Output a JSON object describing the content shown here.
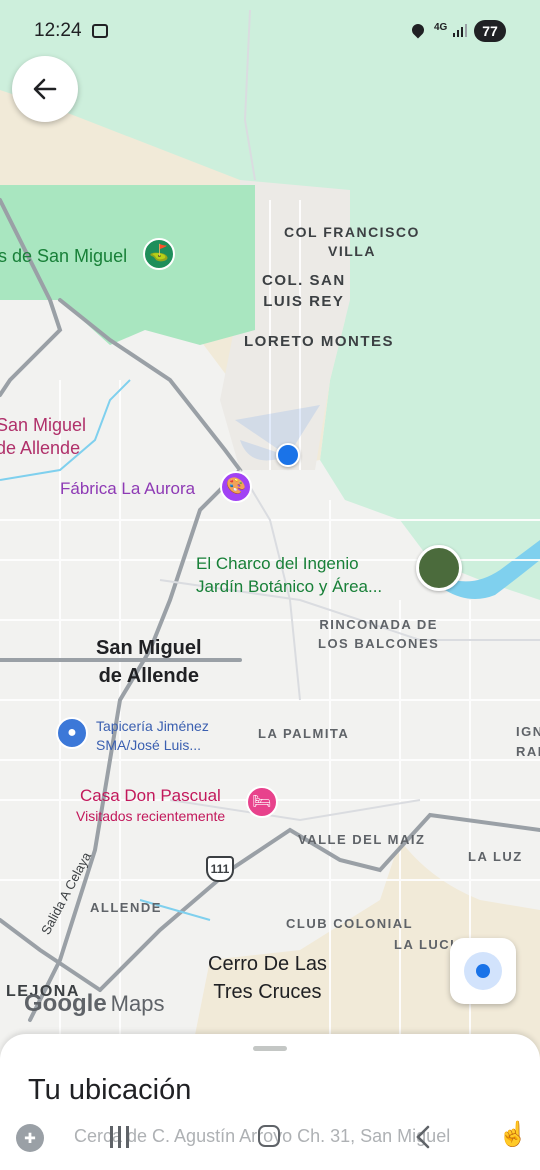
{
  "status_bar": {
    "time": "12:24",
    "network": "4G",
    "battery": "77"
  },
  "map": {
    "areas": {
      "col_francisco_villa": "COL FRANCISCO\nVILLA",
      "col_san_luis_rey": "COL. SAN\nLUIS REY",
      "loreto_montes": "LORETO MONTES",
      "rinconada": "RINCONADA DE\nLOS BALCONES",
      "la_palmita": "LA PALMITA",
      "valle_del_maiz": "VALLE DEL MAIZ",
      "la_luz": "LA LUZ",
      "club_colonial": "CLUB COLONIAL",
      "la_lucia": "LA LUCIA",
      "allende": "ALLENDE",
      "lejona": "LEJONA",
      "ign": "IGN\nRAI"
    },
    "cities": {
      "san_miguel": "San Miguel\nde Allende",
      "cerro": "Cerro De Las\nTres Cruces"
    },
    "pois": {
      "parque": "s de San Miguel",
      "san_miguel_allende_left": "San Miguel\nde Allende",
      "fabrica": "Fábrica La Aurora",
      "charco": "El Charco del Ingenio\nJardín Botánico y Área...",
      "tapiceria": "Tapicería Jiménez\nSMA/José Luis...",
      "casa_don_pascual": "Casa Don Pascual",
      "visitados": "Visitados recientemente"
    },
    "roads": {
      "salida_celaya": "Salida A Celaya",
      "shield_111": "111"
    },
    "logo": {
      "google": "Google",
      "maps": "Maps"
    }
  },
  "sheet": {
    "title": "Tu ubicación",
    "address": "Cerca de C. Agustín Arroyo Ch. 31, San Miguel"
  },
  "colors": {
    "accent_blue": "#1a73e8",
    "park_green": "#c8f1d9",
    "forest_green": "#ccefdf",
    "water": "#7fd0ee"
  }
}
